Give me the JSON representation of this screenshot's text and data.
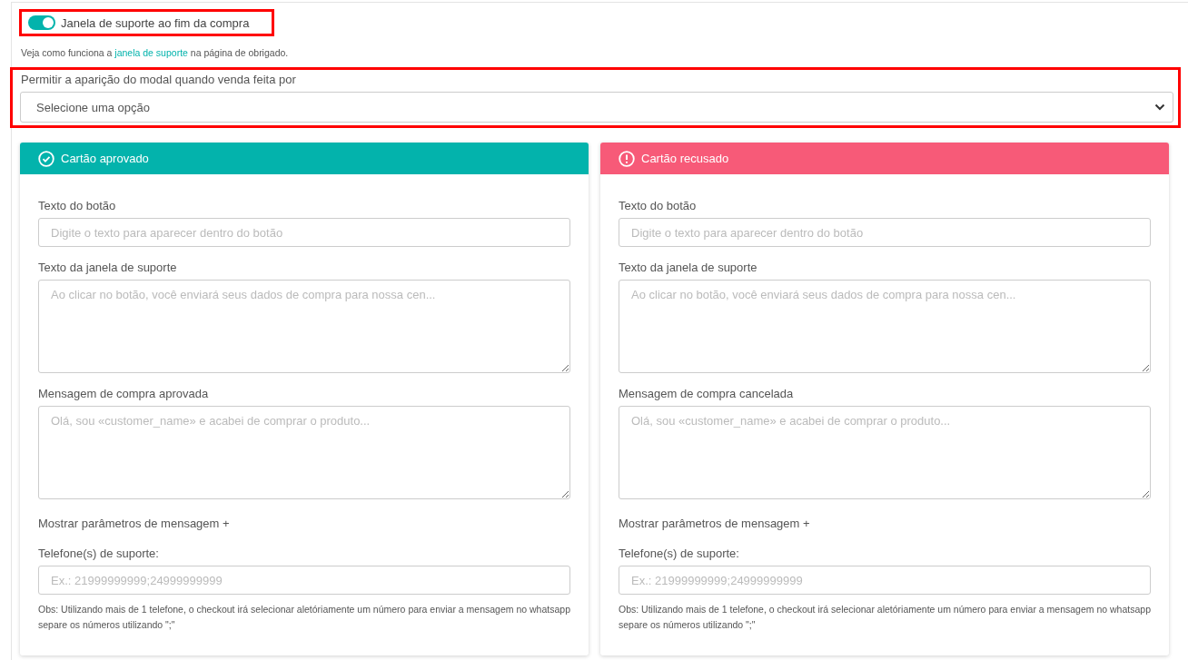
{
  "support_window": {
    "label": "Janela de suporte ao fim da compra",
    "on": true,
    "highlighted": true
  },
  "help_note": {
    "before": "Veja como funciona a ",
    "link": "janela de suporte",
    "after": " na página de obrigado."
  },
  "modal_select": {
    "label": "Permitir a aparição do modal quando venda feita por",
    "placeholder": "Selecione uma opção",
    "highlighted": true
  },
  "cards": [
    {
      "kind": "success",
      "title": "Cartão aprovado",
      "color": "#03b3ac",
      "fields": [
        {
          "kind": "input",
          "label": "Texto do botão",
          "placeholder": "Digite o texto para aparecer dentro do botão"
        },
        {
          "kind": "textarea",
          "label": "Texto da janela de suporte",
          "placeholder": "Ao clicar no botão, você enviará seus dados de compra para nossa cen..."
        },
        {
          "kind": "textarea",
          "label": "Mensagem de compra aprovada",
          "placeholder": "Olá, sou «customer_name» e acabei de comprar o produto..."
        }
      ],
      "params_link": "Mostrar parâmetros de mensagem +",
      "phone_label": "Telefone(s) de suporte:",
      "phone_placeholder": "Ex.: 21999999999;24999999999",
      "phone_note": "Obs: Utilizando mais de 1 telefone, o checkout irá selecionar aletóriamente um número para enviar a mensagem no whatsapp separe os números utilizando \";\""
    },
    {
      "kind": "danger",
      "title": "Cartão recusado",
      "color": "#f75a78",
      "fields": [
        {
          "kind": "input",
          "label": "Texto do botão",
          "placeholder": "Digite o texto para aparecer dentro do botão"
        },
        {
          "kind": "textarea",
          "label": "Texto da janela de suporte",
          "placeholder": "Ao clicar no botão, você enviará seus dados de compra para nossa cen..."
        },
        {
          "kind": "textarea",
          "label": "Mensagem de compra cancelada",
          "placeholder": "Olá, sou «customer_name» e acabei de comprar o produto..."
        }
      ],
      "params_link": "Mostrar parâmetros de mensagem +",
      "phone_label": "Telefone(s) de suporte:",
      "phone_placeholder": "Ex.: 21999999999;24999999999",
      "phone_note": "Obs: Utilizando mais de 1 telefone, o checkout irá selecionar aletóriamente um número para enviar a mensagem no whatsapp separe os números utilizando \";\""
    }
  ]
}
